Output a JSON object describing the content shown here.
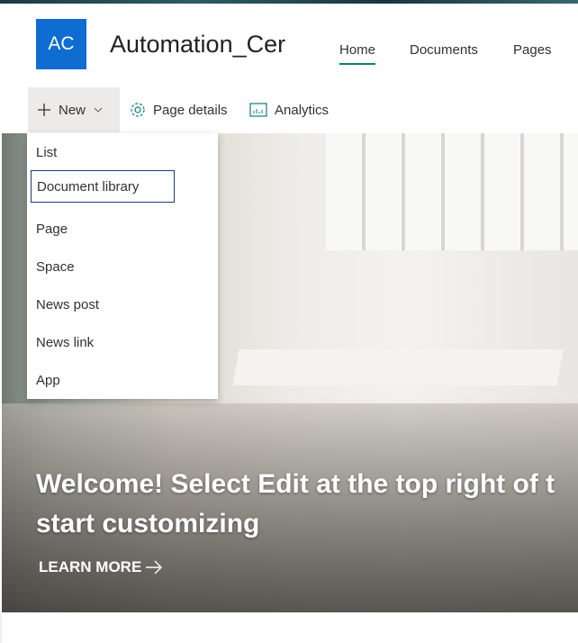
{
  "site": {
    "logo_text": "AC",
    "title": "Automation_Cer",
    "logo_color": "#0f6cd0"
  },
  "nav": [
    {
      "label": "Home",
      "active": true
    },
    {
      "label": "Documents"
    },
    {
      "label": "Pages"
    }
  ],
  "commands": {
    "new": "New",
    "page_details": "Page details",
    "analytics": "Analytics"
  },
  "new_menu": {
    "items": [
      "List",
      "Document library",
      "Page",
      "Space",
      "News post",
      "News link",
      "App"
    ],
    "focused": "Document library"
  },
  "hero": {
    "title": "Welcome! Select Edit at the top right of t start customizing",
    "title_line1": "Welcome! Select Edit at the top right of t",
    "title_line2": "start customizing",
    "link": "LEARN MORE"
  }
}
